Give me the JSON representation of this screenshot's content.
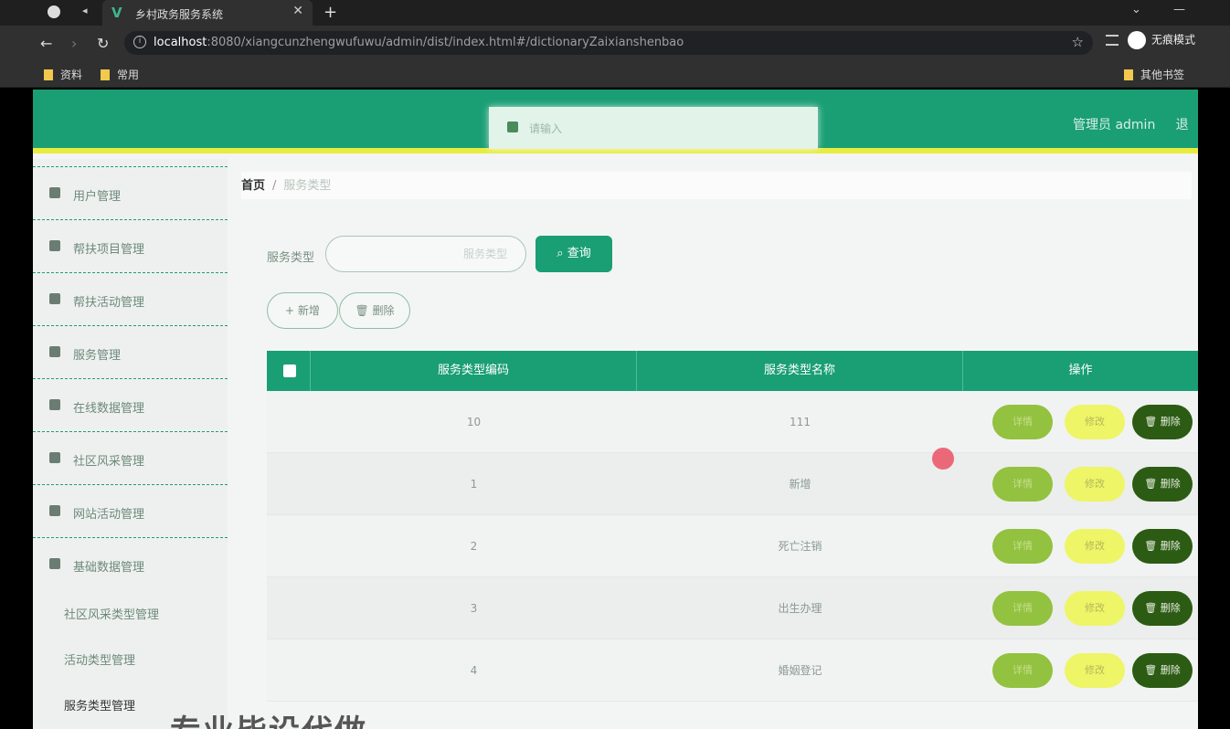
{
  "browser": {
    "tab_title": "乡村政务服务系统",
    "tab_favicon": "V",
    "url_host": "localhost",
    "url_rest": ":8080/xiangcunzhengwufuwu/admin/dist/index.html#/dictionaryZaixianshenbao",
    "profile_label": "无痕模式",
    "bookmarks": [
      "资料",
      "常用"
    ],
    "other_bookmarks": "其他书签"
  },
  "header": {
    "search_placeholder": "请输入",
    "admin_label": "管理员 admin",
    "logout_partial": "退"
  },
  "sidebar": {
    "items": [
      {
        "label": "用户管理",
        "icon": "user-icon"
      },
      {
        "label": "帮扶项目管理",
        "icon": "grid-icon"
      },
      {
        "label": "帮扶活动管理",
        "icon": "flag-icon"
      },
      {
        "label": "服务管理",
        "icon": "service-icon"
      },
      {
        "label": "在线数据管理",
        "icon": "data-icon"
      },
      {
        "label": "社区风采管理",
        "icon": "people-icon"
      },
      {
        "label": "网站活动管理",
        "icon": "activity-icon"
      },
      {
        "label": "基础数据管理",
        "icon": "database-icon"
      }
    ],
    "sub_items": [
      {
        "label": "社区风采类型管理"
      },
      {
        "label": "活动类型管理"
      },
      {
        "label": "服务类型管理"
      }
    ]
  },
  "breadcrumb": {
    "home": "首页",
    "separator": "/",
    "current": "服务类型"
  },
  "filter": {
    "label": "服务类型",
    "placeholder": "服务类型",
    "query_button": "查询"
  },
  "toolbar": {
    "add_button": "新增",
    "delete_button": "删除"
  },
  "table": {
    "headers": [
      "服务类型编码",
      "服务类型名称",
      "操作"
    ],
    "rows": [
      {
        "code": "10",
        "name": "111"
      },
      {
        "code": "1",
        "name": "新增"
      },
      {
        "code": "2",
        "name": "死亡注销"
      },
      {
        "code": "3",
        "name": "出生办理"
      },
      {
        "code": "4",
        "name": "婚姻登记"
      }
    ],
    "actions": {
      "view": "详情",
      "edit": "修改",
      "delete": "删除"
    }
  },
  "watermark": "专业毕设代做"
}
